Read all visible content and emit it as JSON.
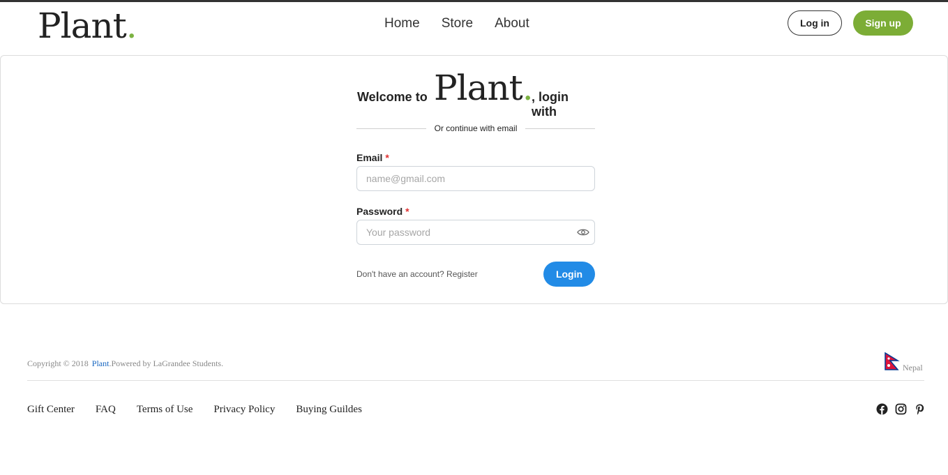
{
  "header": {
    "logo_text": "Plant",
    "logo_dot": ".",
    "nav": [
      "Home",
      "Store",
      "About"
    ],
    "login_label": "Log in",
    "signup_label": "Sign up"
  },
  "form": {
    "welcome_prefix": "Welcome to",
    "welcome_logo": "Plant",
    "welcome_logo_dot": ".",
    "welcome_suffix": ", login with",
    "divider_text": "Or continue with email",
    "email_label": "Email",
    "email_required": "*",
    "email_placeholder": "name@gmail.com",
    "password_label": "Password",
    "password_required": "*",
    "password_placeholder": "Your password",
    "register_prompt": "Don't have an account? Register",
    "login_button": "Login"
  },
  "footer": {
    "copyright_text": "Copyright © 2018",
    "brand": "Plant",
    "powered_by": ".Powered by LaGrandee Students.",
    "country": "Nepal",
    "links": [
      "Gift Center",
      "FAQ",
      "Terms of Use",
      "Privacy Policy",
      "Buying Guildes"
    ],
    "social_icons": [
      "facebook-icon",
      "instagram-icon",
      "pinterest-icon"
    ]
  },
  "colors": {
    "accent_green": "#7cad36",
    "primary_blue": "#228be6",
    "required_red": "#e03131",
    "link_blue": "#1565c0"
  }
}
